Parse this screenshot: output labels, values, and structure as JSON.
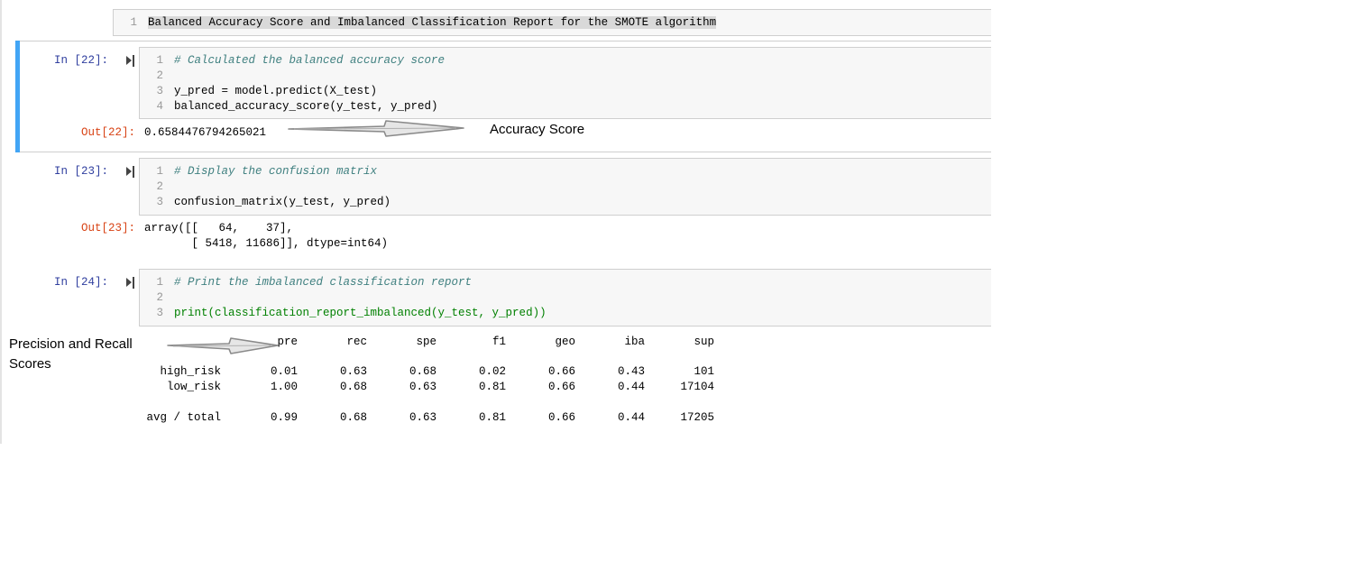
{
  "markdown_cell": {
    "line_no": "1",
    "text": "Balanced Accuracy Score and Imbalanced Classification Report for the SMOTE algorithm"
  },
  "cell22": {
    "prompt_in": "In [22]:",
    "lines": [
      {
        "n": "1",
        "text": "# Calculated the balanced accuracy score"
      },
      {
        "n": "2",
        "text": ""
      },
      {
        "n": "3",
        "text": "y_pred = model.predict(X_test)"
      },
      {
        "n": "4",
        "text": "balanced_accuracy_score(y_test, y_pred)"
      }
    ],
    "prompt_out": "Out[22]:",
    "output": "0.6584476794265021"
  },
  "cell23": {
    "prompt_in": "In [23]:",
    "lines": [
      {
        "n": "1",
        "text": "# Display the confusion matrix"
      },
      {
        "n": "2",
        "text": ""
      },
      {
        "n": "3",
        "text": "confusion_matrix(y_test, y_pred)"
      }
    ],
    "prompt_out": "Out[23]:",
    "output_lines": [
      "array([[   64,    37],",
      "       [ 5418, 11686]], dtype=int64)"
    ]
  },
  "cell24": {
    "prompt_in": "In [24]:",
    "lines": [
      {
        "n": "1",
        "text": "# Print the imbalanced classification report"
      },
      {
        "n": "2",
        "text": ""
      },
      {
        "n": "3",
        "text": "print(classification_report_imbalanced(y_test, y_pred))"
      }
    ],
    "report": {
      "headers": [
        "pre",
        "rec",
        "spe",
        "f1",
        "geo",
        "iba",
        "sup"
      ],
      "rows": [
        {
          "label": "high_risk",
          "values": [
            "0.01",
            "0.63",
            "0.68",
            "0.02",
            "0.66",
            "0.43",
            "101"
          ]
        },
        {
          "label": "low_risk",
          "values": [
            "1.00",
            "0.68",
            "0.63",
            "0.81",
            "0.66",
            "0.44",
            "17104"
          ]
        },
        {
          "label": "avg / total",
          "values": [
            "0.99",
            "0.68",
            "0.63",
            "0.81",
            "0.66",
            "0.44",
            "17205"
          ]
        }
      ]
    }
  },
  "annotations": {
    "accuracy": "Accuracy Score",
    "precision_line1": "Precision and Recall",
    "precision_line2": "Scores"
  },
  "colors": {
    "prompt_in": "#303f9f",
    "prompt_out": "#d84315",
    "selected_accent": "#42a5f5",
    "comment": "#408080"
  }
}
